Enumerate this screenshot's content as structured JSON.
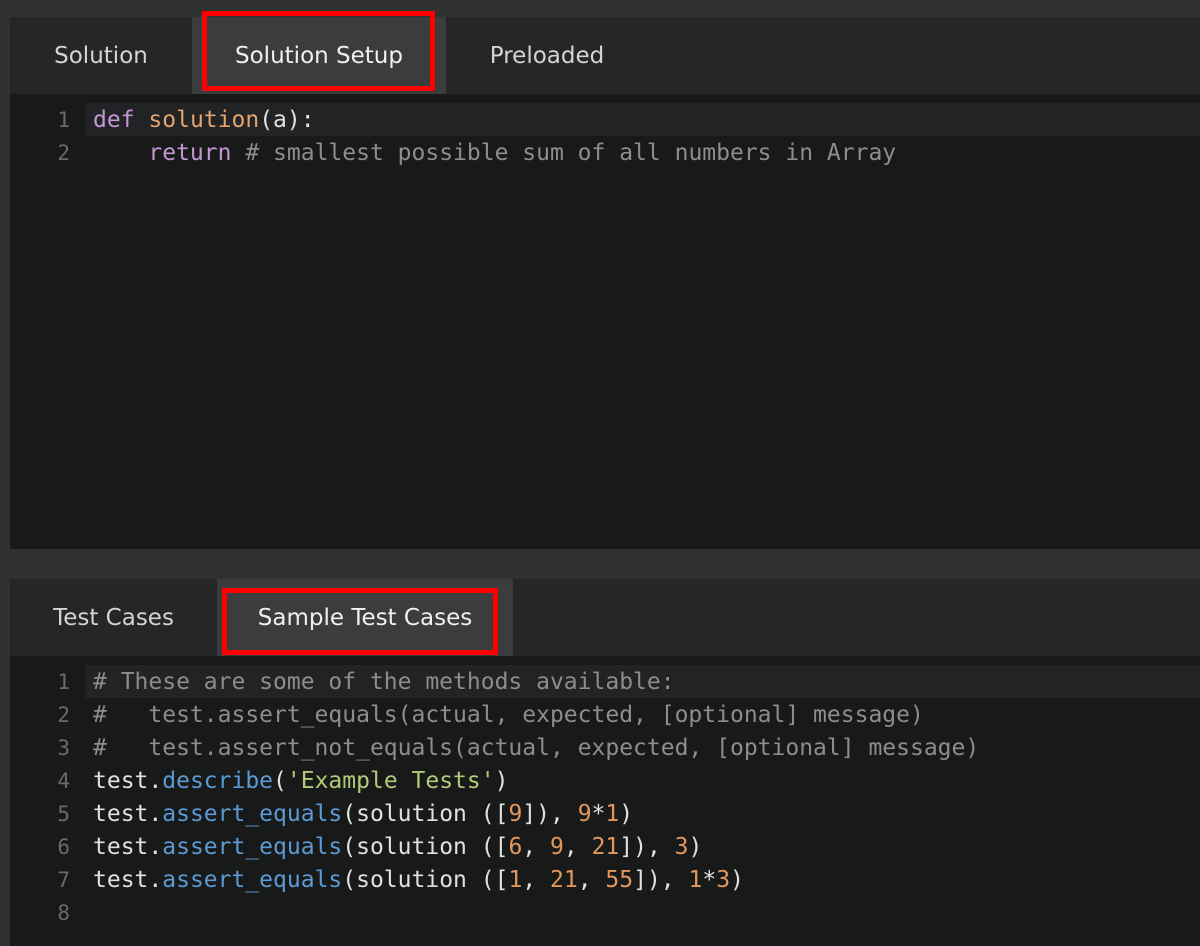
{
  "top_panel": {
    "tabs": [
      {
        "label": "Solution"
      },
      {
        "label": "Solution Setup"
      },
      {
        "label": "Preloaded"
      }
    ],
    "editor": {
      "line_numbers": [
        "1",
        "2"
      ],
      "line1": {
        "kw": "def",
        "fn": "solution",
        "rest": "(a):"
      },
      "line2": {
        "indent": "    ",
        "kw": "return",
        "comment": " # smallest possible sum of all numbers in Array"
      }
    }
  },
  "bottom_panel": {
    "tabs": [
      {
        "label": "Test Cases"
      },
      {
        "label": "Sample Test Cases"
      }
    ],
    "editor": {
      "line_numbers": [
        "1",
        "2",
        "3",
        "4",
        "5",
        "6",
        "7",
        "8"
      ],
      "comment1": "# These are some of the methods available:",
      "comment2": "#   test.assert_equals(actual, expected, [optional] message)",
      "comment3": "#   test.assert_not_equals(actual, expected, [optional] message)",
      "line4": {
        "obj": "test",
        "dot": ".",
        "method": "describe",
        "open": "(",
        "str": "'Example Tests'",
        "close": ")"
      },
      "line5": {
        "obj": "test",
        "dot": ".",
        "method": "assert_equals",
        "a": "(solution ([",
        "n1": "9",
        "b": "]), ",
        "n2": "9",
        "op": "*",
        "n3": "1",
        "c": ")"
      },
      "line6": {
        "obj": "test",
        "dot": ".",
        "method": "assert_equals",
        "a": "(solution ([",
        "n1": "6",
        "s1": ", ",
        "n2": "9",
        "s2": ", ",
        "n3": "21",
        "b": "]), ",
        "n4": "3",
        "c": ")"
      },
      "line7": {
        "obj": "test",
        "dot": ".",
        "method": "assert_equals",
        "a": "(solution ([",
        "n1": "1",
        "s1": ", ",
        "n2": "21",
        "s2": ", ",
        "n3": "55",
        "b": "]), ",
        "n4": "1",
        "op": "*",
        "n5": "3",
        "c": ")"
      }
    }
  },
  "colors": {
    "highlight": "#ff0000",
    "keyword": "#c596d6",
    "function": "#e3a36b",
    "comment": "#8d8d8d",
    "method": "#5b9ad4",
    "string": "#b6c879",
    "number": "#e3975c"
  }
}
